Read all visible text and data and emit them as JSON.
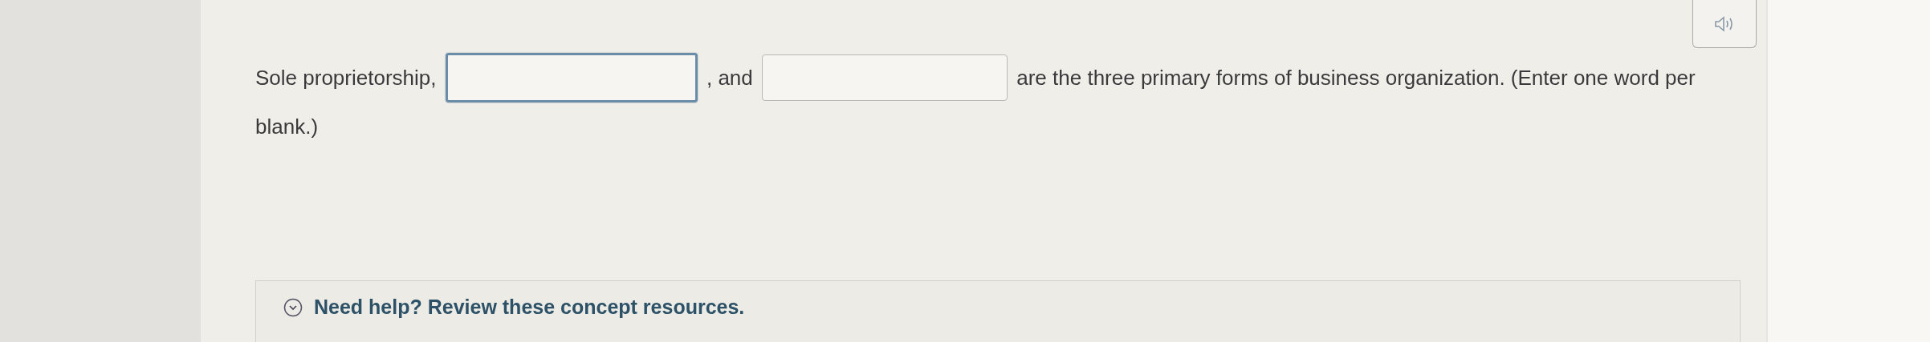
{
  "audio_button": {
    "kind": "speaker"
  },
  "question": {
    "parts": [
      {
        "kind": "text",
        "text": "Sole proprietorship,"
      },
      {
        "kind": "blank",
        "focused": true
      },
      {
        "kind": "text",
        "text": ", and"
      },
      {
        "kind": "blank",
        "focused": false
      },
      {
        "kind": "text",
        "text": "are the three primary forms of business organization. (Enter one word per"
      },
      {
        "kind": "line",
        "text": "blank.)"
      }
    ]
  },
  "help": {
    "text": "Need help? Review these concept resources.",
    "expanded": false
  }
}
